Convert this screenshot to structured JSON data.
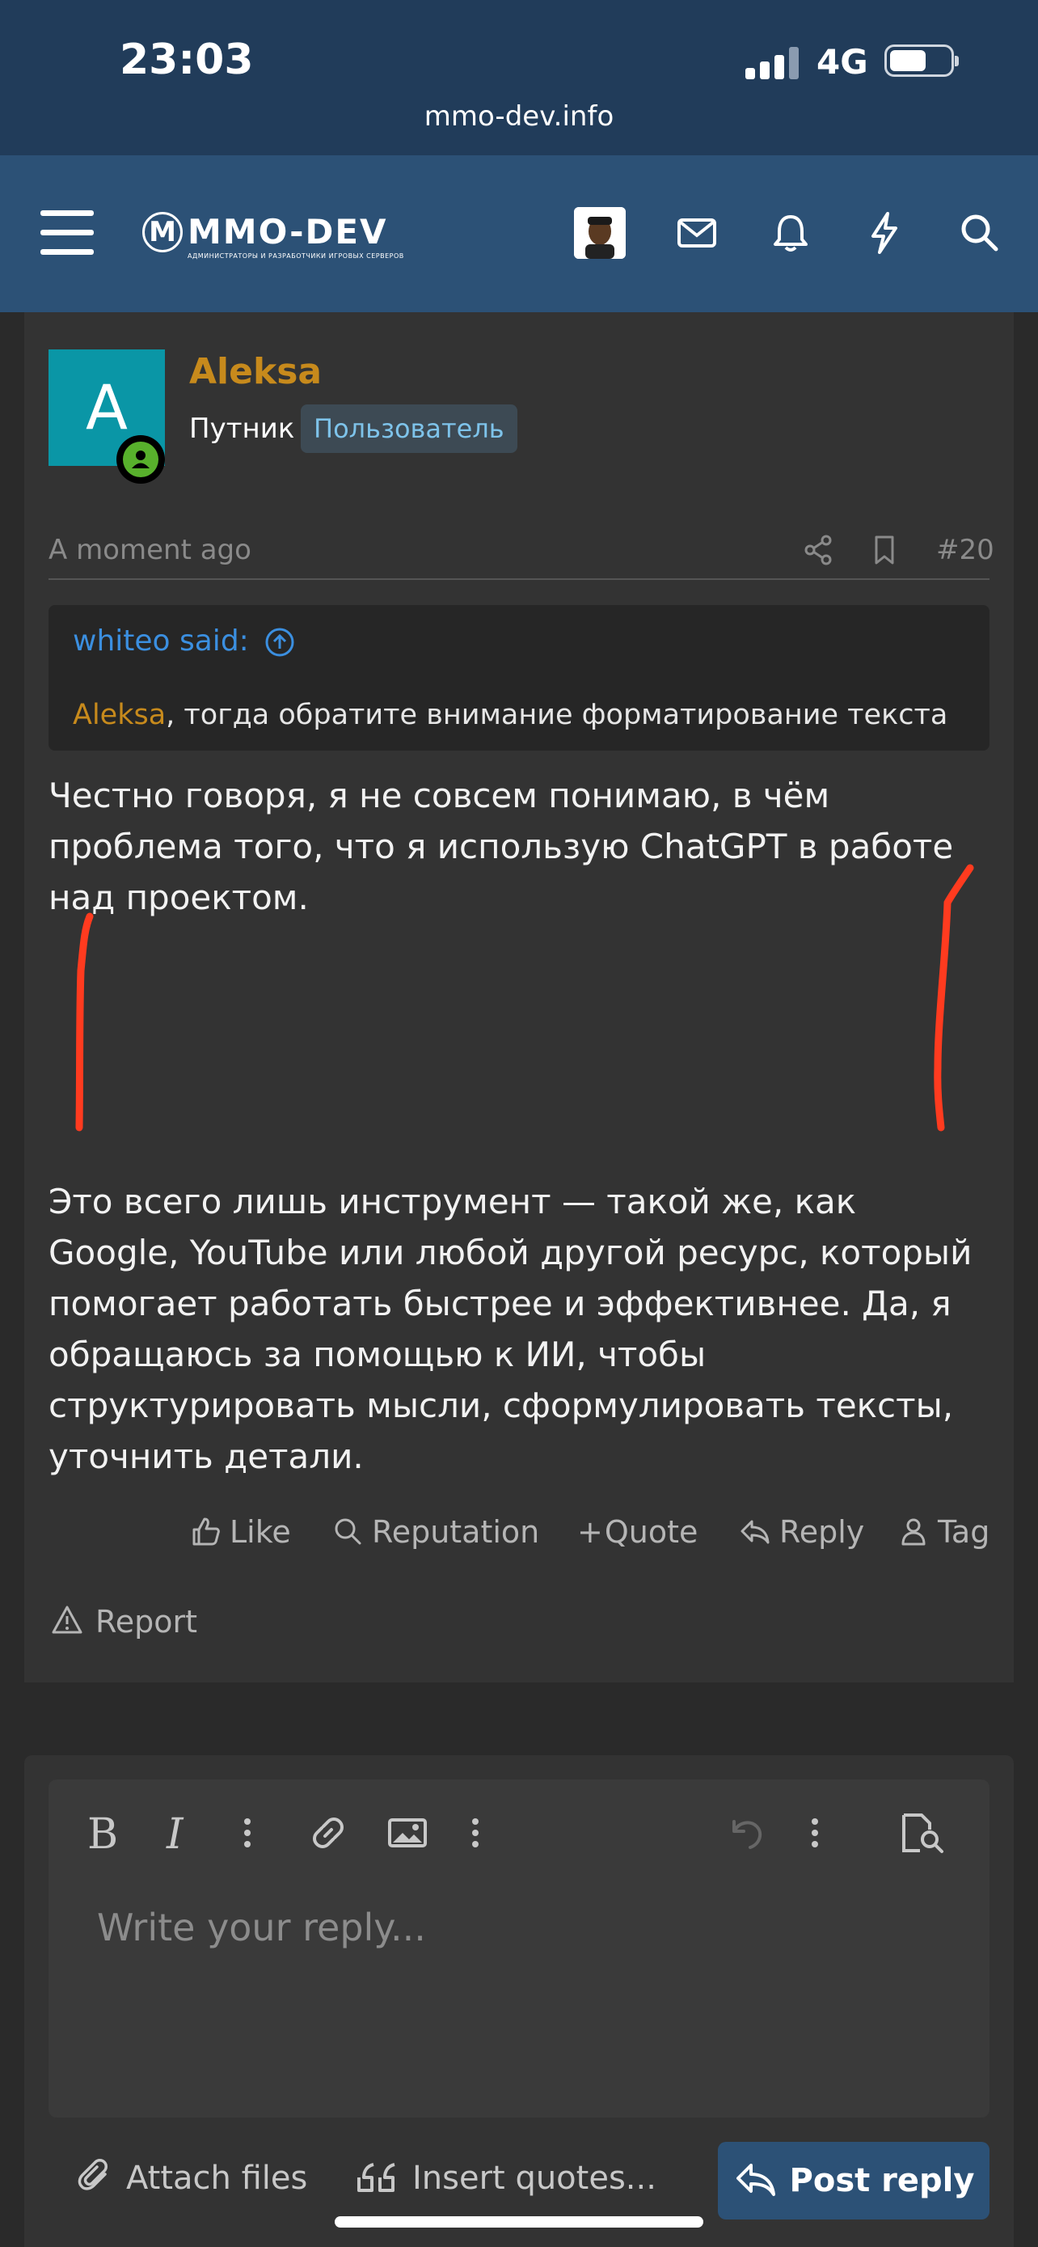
{
  "status": {
    "time": "23:03",
    "network": "4G",
    "url": "mmo-dev.info"
  },
  "nav": {
    "logo_text": "MMO-DEV",
    "logo_subtitle": "АДМИНИСТРАТОРЫ И РАЗРАБОТЧИКИ ИГРОВЫХ СЕРВЕРОВ",
    "icons": [
      "menu-icon",
      "avatar",
      "mail-icon",
      "bell-icon",
      "lightning-icon",
      "search-icon"
    ]
  },
  "post": {
    "avatar_letter": "A",
    "username": "Aleksa",
    "user_title": "Путник",
    "user_badge": "Пользователь",
    "time": "A moment ago",
    "number": "#20",
    "quote": {
      "author": "whiteo said:",
      "mention": "Aleksa",
      "text": ", тогда обратите внимание форматирование текста"
    },
    "message_1": "Честно говоря, я не совсем понимаю, в чём проблема того, что я использую ChatGPT в работе над проектом.",
    "message_2": "Это всего лишь инструмент — такой же, как Google, YouTube или любой другой ресурс, который помогает работать быстрее и эффективнее. Да, я обращаюсь за помощью к ИИ, чтобы структурировать мысли, сформулировать тексты, уточнить детали.",
    "actions": {
      "like": "Like",
      "reputation": "Reputation",
      "quote": "Quote",
      "reply": "Reply",
      "tag": "Tag",
      "report": "Report"
    }
  },
  "editor": {
    "toolbar": [
      "bold-icon",
      "italic-icon",
      "more-icon",
      "link-icon",
      "image-icon",
      "more-icon",
      "undo-icon",
      "more-icon",
      "preview-icon"
    ],
    "placeholder": "Write your reply..."
  },
  "reply_bar": {
    "attach": "Attach files",
    "insert_quotes": "Insert quotes...",
    "post_reply": "Post reply"
  },
  "colors": {
    "status_bg": "#213c5a",
    "nav_bg": "#2c5176",
    "username": "#c78a1c",
    "link": "#3b8fe0",
    "annotation": "#ff3b1f"
  }
}
